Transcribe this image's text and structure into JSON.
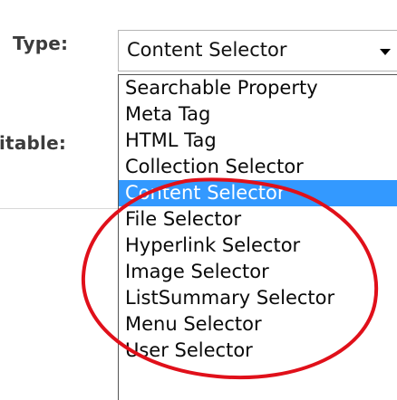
{
  "form": {
    "type_label": "Type:",
    "editable_label": "itable:"
  },
  "type_select": {
    "selected_value": "Content Selector",
    "options": [
      "Searchable Property",
      "Meta Tag",
      "HTML Tag",
      "Collection Selector",
      "Content Selector",
      "File Selector",
      "Hyperlink Selector",
      "Image Selector",
      "ListSummary Selector",
      "Menu Selector",
      "User Selector"
    ],
    "highlighted_option": "Content Selector"
  },
  "colors": {
    "selection_highlight": "#3399ff",
    "annotation_circle": "#e0101a"
  },
  "icons": {
    "dropdown_arrow": "chevron-down-icon"
  }
}
